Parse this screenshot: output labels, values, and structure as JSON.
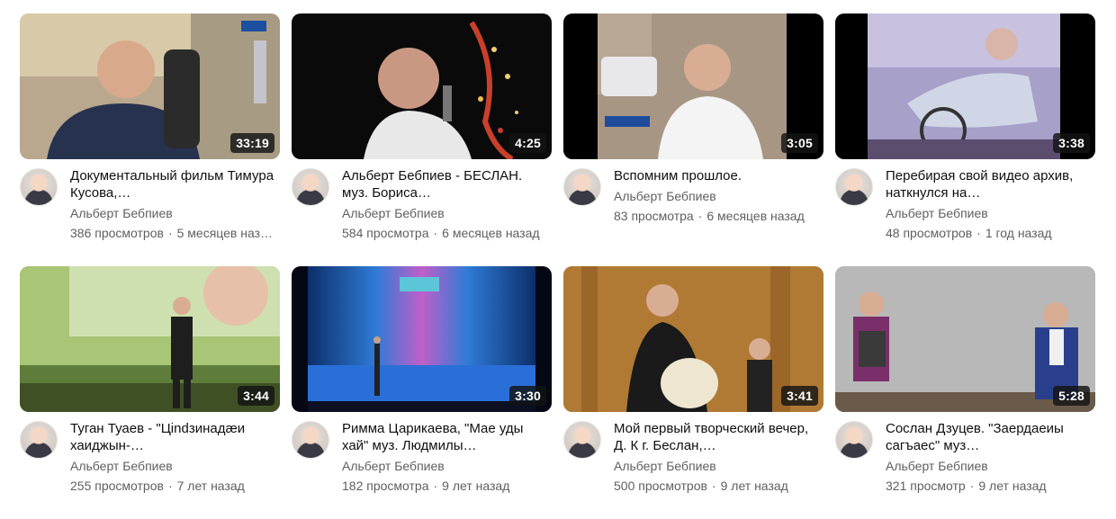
{
  "videos": [
    {
      "title": "Документальный фильм Тимура Кусова,…",
      "channel": "Альберт Бебпиев",
      "views": "386 просмотров",
      "age": "5 месяцев наз…",
      "duration": "33:19"
    },
    {
      "title": "Альберт Бебпиев - БЕСЛАН. муз. Бориса…",
      "channel": "Альберт Бебпиев",
      "views": "584 просмотра",
      "age": "6 месяцев назад",
      "duration": "4:25"
    },
    {
      "title": "Вспомним прошлое.",
      "channel": "Альберт Бебпиев",
      "views": "83 просмотра",
      "age": "6 месяцев назад",
      "duration": "3:05"
    },
    {
      "title": "Перебирая свой видео архив, наткнулся на…",
      "channel": "Альберт Бебпиев",
      "views": "48 просмотров",
      "age": "1 год назад",
      "duration": "3:38"
    },
    {
      "title": "Туган Туаев - \"Цindзинадæи хаиджын-…",
      "channel": "Альберт Бебпиев",
      "views": "255 просмотров",
      "age": "7 лет назад",
      "duration": "3:44"
    },
    {
      "title": "Римма Царикаева, \"Мае уды хай\" муз. Людмилы…",
      "channel": "Альберт Бебпиев",
      "views": "182 просмотра",
      "age": "9 лет назад",
      "duration": "3:30"
    },
    {
      "title": "Мой первый творческий вечер, Д. К г. Беслан,…",
      "channel": "Альберт Бебпиев",
      "views": "500 просмотров",
      "age": "9 лет назад",
      "duration": "3:41"
    },
    {
      "title": "Сослан Дзуцев. \"Заердаеиы сагъаес\" муз…",
      "channel": "Альберт Бебпиев",
      "views": "321 просмотр",
      "age": "9 лет назад",
      "duration": "5:28"
    }
  ],
  "separator": "·"
}
